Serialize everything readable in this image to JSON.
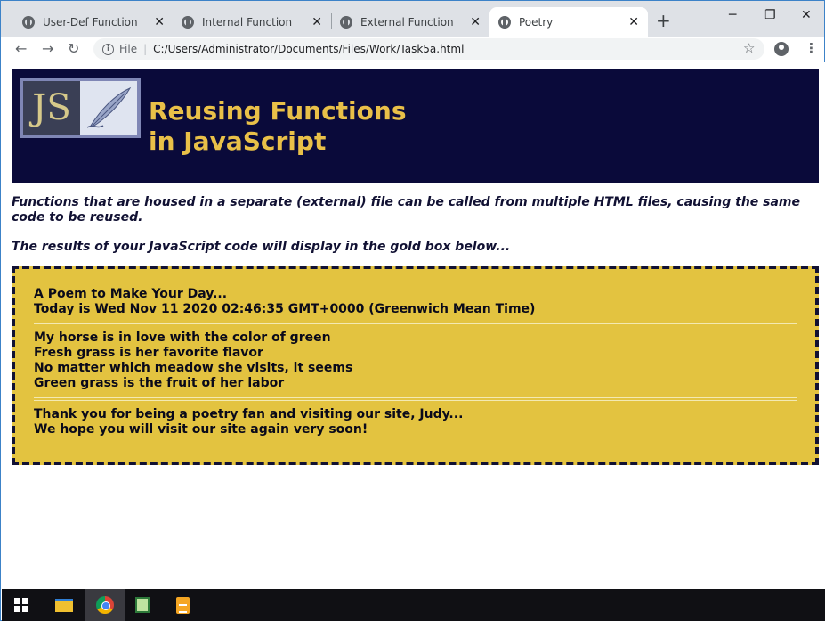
{
  "browser": {
    "tabs": [
      {
        "label": "User-Def Function",
        "active": false
      },
      {
        "label": "Internal Function",
        "active": false
      },
      {
        "label": "External Function",
        "active": false
      },
      {
        "label": "Poetry",
        "active": true
      }
    ],
    "new_tab_glyph": "+",
    "address": {
      "scheme_label": "File",
      "url": "C:/Users/Administrator/Documents/Files/Work/Task5a.html"
    }
  },
  "page": {
    "banner": {
      "logo_text": "JS",
      "title_line1": "Reusing Functions",
      "title_line2": "in JavaScript"
    },
    "intro_text": "Functions that are housed in a separate (external) file can be called from multiple HTML files, causing the same code to be reused.",
    "results_text": "The results of your JavaScript code will display in the gold box below...",
    "goldbox": {
      "heading": "A Poem to Make Your Day...",
      "date_line": "Today is Wed Nov 11 2020 02:46:35 GMT+0000 (Greenwich Mean Time)",
      "poem": [
        "My horse is in love with the color of green",
        "Fresh grass is her favorite flavor",
        "No matter which meadow she visits, it seems",
        "Green grass is the fruit of her labor"
      ],
      "thanks_line": "Thank you for being a poetry fan and visiting our site, Judy...",
      "visit_line": "We hope you will visit our site again very soon!"
    }
  },
  "taskbar": {
    "icons": [
      "windows-start-icon",
      "file-explorer-icon",
      "chrome-icon",
      "notepad-plus-icon",
      "document-icon"
    ]
  },
  "colors": {
    "banner_bg": "#0a0a3a",
    "banner_title": "#e9c048",
    "goldbox_bg": "#e3c340",
    "text_dark": "#111133"
  }
}
